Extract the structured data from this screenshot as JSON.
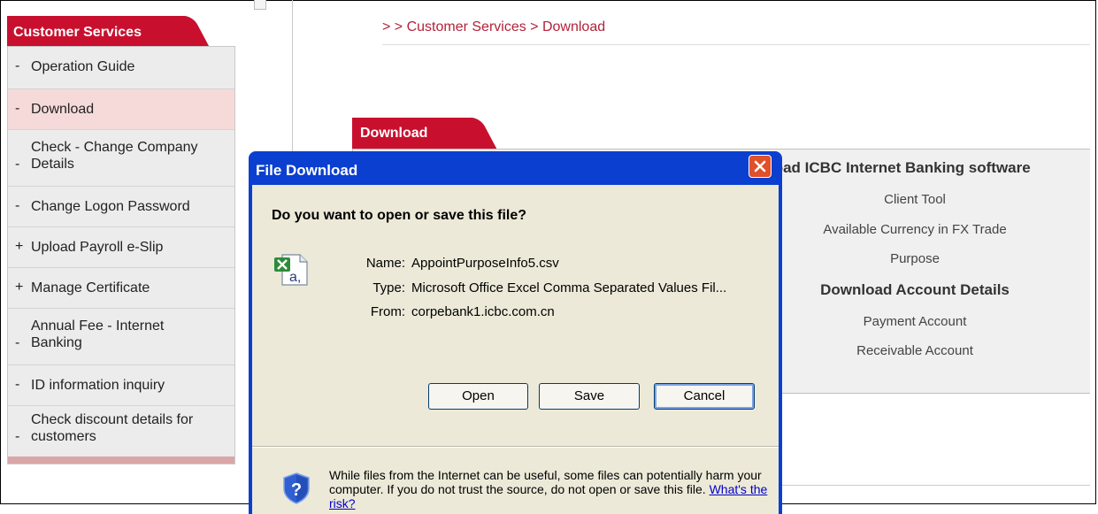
{
  "sidebar": {
    "title": "Customer Services",
    "items": [
      {
        "marker": "-",
        "label": "Operation Guide"
      },
      {
        "marker": "-",
        "label": "Download"
      },
      {
        "marker": "-",
        "label": "Check - Change Company Details"
      },
      {
        "marker": "-",
        "label": "Change Logon Password"
      },
      {
        "marker": "+",
        "label": "Upload Payroll e-Slip"
      },
      {
        "marker": "+",
        "label": "Manage Certificate"
      },
      {
        "marker": "-",
        "label": "Annual Fee - Internet Banking"
      },
      {
        "marker": "-",
        "label": "ID information inquiry"
      },
      {
        "marker": "-",
        "label": "Check discount details for customers"
      }
    ]
  },
  "breadcrumb": "> > Customer Services > Download",
  "panel": {
    "tab": "Download",
    "heading": "load ICBC Internet Banking software",
    "links": [
      "Client Tool",
      "Available Currency in FX Trade",
      "Purpose"
    ],
    "subheading": "Download Account Details",
    "account_links": [
      "Payment Account",
      "Receivable Account"
    ]
  },
  "dialog": {
    "title": "File Download",
    "question": "Do you want to open or save this file?",
    "name_label": "Name:",
    "name_value": "AppointPurposeInfo5.csv",
    "type_label": "Type:",
    "type_value": "Microsoft Office Excel Comma Separated Values Fil...",
    "from_label": "From:",
    "from_value": "corpebank1.icbc.com.cn",
    "open_label": "Open",
    "save_label": "Save",
    "cancel_label": "Cancel",
    "warning_text": "While files from the Internet can be useful, some files can potentially harm your computer. If you do not trust the source, do not open or save this file. ",
    "risk_link": "What's the risk?"
  },
  "colors": {
    "accent": "#c8102e",
    "dialog_title": "#0a3fd0",
    "dialog_body": "#ece9d8"
  },
  "icons": [
    "excel-csv-file-icon",
    "close-icon",
    "security-shield-icon"
  ]
}
